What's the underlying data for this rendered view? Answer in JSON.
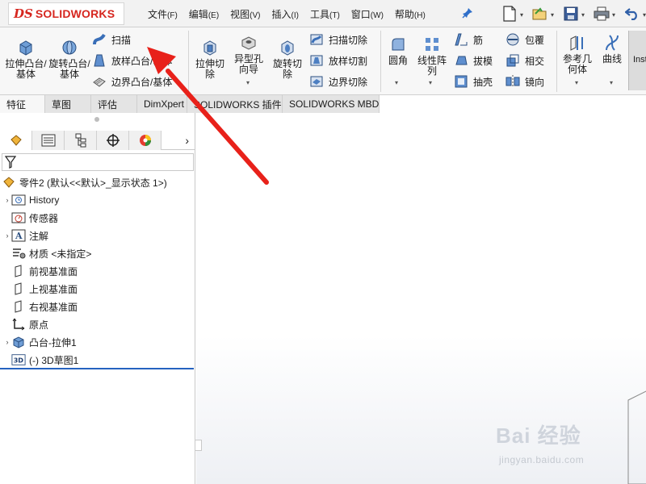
{
  "app": {
    "logo_ds": "DS",
    "logo_text": "SOLIDWORKS"
  },
  "menu": {
    "items": [
      {
        "label": "文件",
        "acc": "(F)"
      },
      {
        "label": "编辑",
        "acc": "(E)"
      },
      {
        "label": "视图",
        "acc": "(V)"
      },
      {
        "label": "插入",
        "acc": "(I)"
      },
      {
        "label": "工具",
        "acc": "(T)"
      },
      {
        "label": "窗口",
        "acc": "(W)"
      },
      {
        "label": "帮助",
        "acc": "(H)"
      }
    ]
  },
  "quick_access": [
    "new-icon",
    "open-icon",
    "save-icon",
    "print-icon",
    "undo-icon"
  ],
  "ribbon": {
    "extruded_boss": "拉伸凸台/基体",
    "revolved_boss": "旋转凸台/基体",
    "sweep": "扫描",
    "loft_boss": "放样凸台/基体",
    "boundary_boss": "边界凸台/基体",
    "extruded_cut": "拉伸切除",
    "hole_wizard": "异型孔向导",
    "revolved_cut": "旋转切除",
    "swept_cut": "扫描切除",
    "lofted_cut": "放样切割",
    "boundary_cut": "边界切除",
    "fillet": "圆角",
    "linear_pattern": "线性阵列",
    "rib": "筋",
    "draft": "拔模",
    "shell": "抽壳",
    "wrap": "包覆",
    "intersect": "相交",
    "mirror": "镜向",
    "ref_geometry": "参考几何体",
    "curves": "曲线",
    "instant3d": "Inst"
  },
  "tabs": [
    {
      "label": "特征",
      "active": true
    },
    {
      "label": "草图",
      "active": false
    },
    {
      "label": "评估",
      "active": false
    },
    {
      "label": "DimXpert",
      "active": false
    },
    {
      "label": "SOLIDWORKS 插件",
      "active": false
    },
    {
      "label": "SOLIDWORKS MBD",
      "active": false
    }
  ],
  "feature_tree": {
    "root": "零件2 (默认<<默认>_显示状态 1>)",
    "items": [
      {
        "label": "History",
        "icon": "history-icon",
        "expandable": true
      },
      {
        "label": "传感器",
        "icon": "sensor-icon",
        "expandable": false
      },
      {
        "label": "注解",
        "icon": "annotation-icon",
        "expandable": true
      },
      {
        "label": "材质 <未指定>",
        "icon": "material-icon",
        "expandable": false
      },
      {
        "label": "前视基准面",
        "icon": "plane-icon",
        "expandable": false
      },
      {
        "label": "上视基准面",
        "icon": "plane-icon",
        "expandable": false
      },
      {
        "label": "右视基准面",
        "icon": "plane-icon",
        "expandable": false
      },
      {
        "label": "原点",
        "icon": "origin-icon",
        "expandable": false
      },
      {
        "label": "凸台-拉伸1",
        "icon": "extrude-icon",
        "expandable": true
      },
      {
        "label": "(-) 3D草图1",
        "icon": "3d-sketch-icon",
        "expandable": false
      }
    ]
  },
  "watermark": {
    "brand": "Bai 经验",
    "url": "jingyan.baidu.com"
  },
  "colors": {
    "brand_red": "#d6261f",
    "annotation_arrow": "#e8211a",
    "rollback_bar": "#2563c0"
  }
}
